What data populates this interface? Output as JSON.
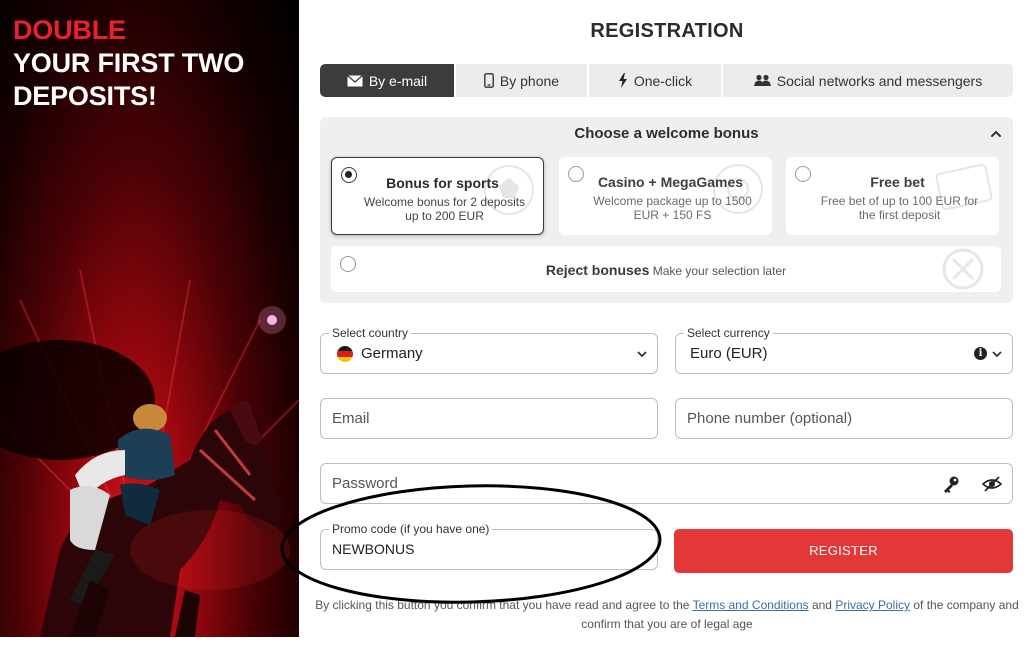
{
  "promo": {
    "line1": "DOUBLE",
    "line2": "YOUR FIRST TWO",
    "line3": "DEPOSITS!"
  },
  "title": "REGISTRATION",
  "tabs": [
    {
      "label": "By e-mail",
      "icon": "envelope-icon",
      "active": true
    },
    {
      "label": "By phone",
      "icon": "phone-icon",
      "active": false
    },
    {
      "label": "One-click",
      "icon": "lightning-icon",
      "active": false
    },
    {
      "label": "Social networks and messengers",
      "icon": "people-icon",
      "active": false
    }
  ],
  "bonus": {
    "title": "Choose a welcome bonus",
    "cards": [
      {
        "title": "Bonus for sports",
        "desc1": "Welcome bonus for 2 deposits",
        "desc2": "up to 200 EUR",
        "selected": true
      },
      {
        "title": "Casino + MegaGames",
        "desc1": "Welcome package up to 1500",
        "desc2": "EUR + 150 FS",
        "selected": false
      },
      {
        "title": "Free bet",
        "desc1": "Free bet of up to 100 EUR for",
        "desc2": "the first deposit",
        "selected": false
      }
    ],
    "reject_title": "Reject bonuses",
    "reject_note": "Make your selection later"
  },
  "form": {
    "country_label": "Select country",
    "country_value": "Germany",
    "currency_label": "Select currency",
    "currency_value": "Euro (EUR)",
    "email_placeholder": "Email",
    "phone_placeholder": "Phone number (optional)",
    "password_placeholder": "Password",
    "promo_label": "Promo code (if you have one)",
    "promo_value": "NEWBONUS"
  },
  "register_label": "REGISTER",
  "legal": {
    "before": "By clicking this button you confirm that you have read and agree to the ",
    "terms": "Terms and Conditions",
    "and": " and ",
    "privacy": "Privacy Policy",
    "after": " of the company and confirm that you are of legal age"
  },
  "colors": {
    "accent_red": "#e23838",
    "promo_red": "#e8212c",
    "active_tab": "#3c3c3c"
  }
}
